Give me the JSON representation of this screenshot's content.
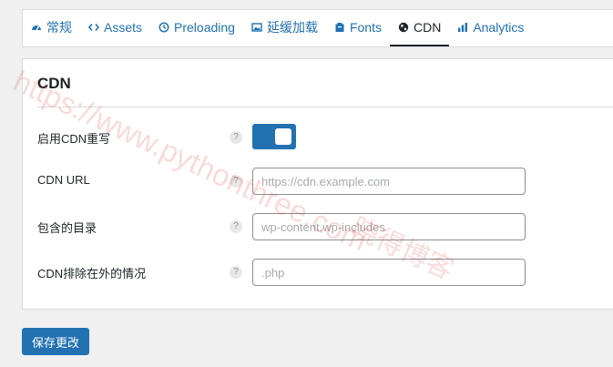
{
  "tabs": [
    {
      "label": "常规",
      "icon": "gauge-icon"
    },
    {
      "label": "Assets",
      "icon": "code-icon"
    },
    {
      "label": "Preloading",
      "icon": "clock-icon"
    },
    {
      "label": "延缓加载",
      "icon": "image-icon"
    },
    {
      "label": "Fonts",
      "icon": "font-icon"
    },
    {
      "label": "CDN",
      "icon": "globe-icon",
      "active": true
    },
    {
      "label": "Analytics",
      "icon": "bar-chart-icon"
    }
  ],
  "panel": {
    "title": "CDN",
    "rows": {
      "enable": {
        "label": "启用CDN重写",
        "help": "?",
        "enabled": true
      },
      "url": {
        "label": "CDN URL",
        "help": "?",
        "value": "",
        "placeholder": "https://cdn.example.com"
      },
      "include": {
        "label": "包含的目录",
        "help": "?",
        "value": "",
        "placeholder": "wp-content,wp-includes"
      },
      "exclude": {
        "label": "CDN排除在外的情况",
        "help": "?",
        "value": "",
        "placeholder": ".php"
      }
    }
  },
  "save_label": "保存更改",
  "watermark": {
    "text": "https://www.pythonthree.com",
    "sub": "晓得博客"
  },
  "colors": {
    "accent": "#2271b1",
    "active_tab": "#1d2327",
    "background": "#f0f0f1",
    "watermark": "#d62828"
  }
}
